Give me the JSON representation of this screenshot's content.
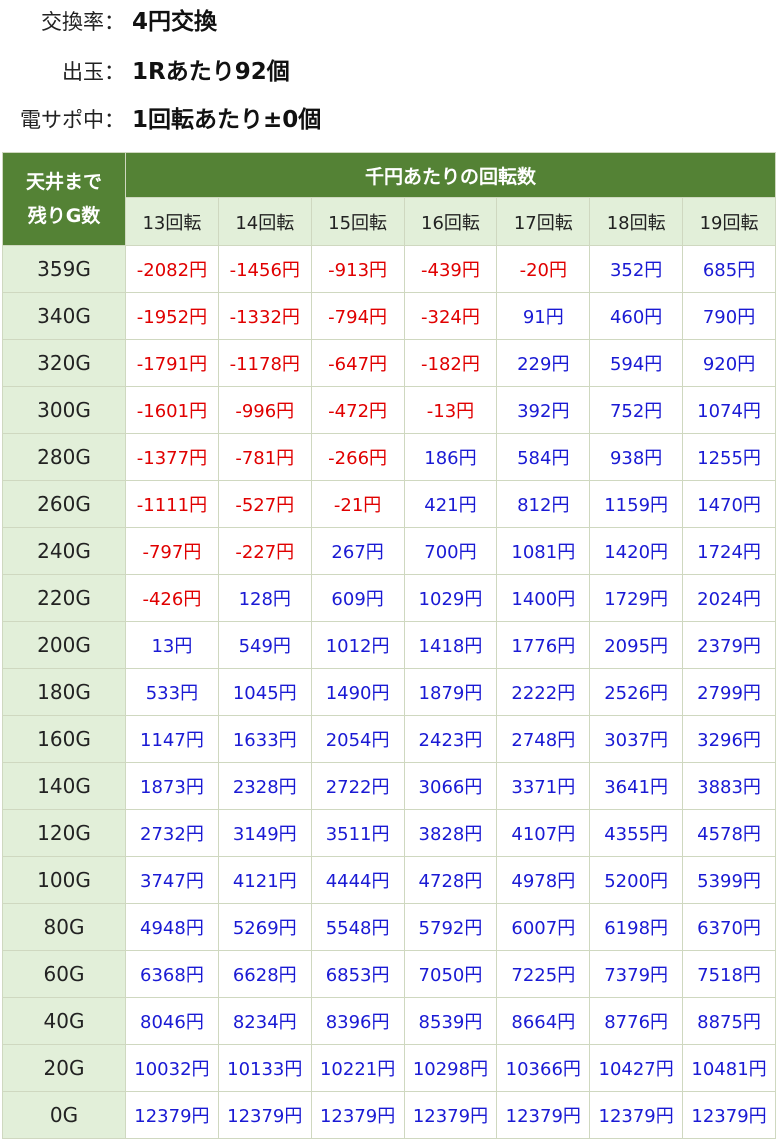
{
  "info": [
    {
      "label": "交換率：",
      "value": "4円交換"
    },
    {
      "label": "出玉：",
      "value": "1Rあたり92個"
    },
    {
      "label": "電サポ中：",
      "value": "1回転あたり±0個"
    }
  ],
  "table": {
    "corner_line1": "天井まで",
    "corner_line2": "残りG数",
    "main_header": "千円あたりの回転数",
    "columns": [
      "13回転",
      "14回転",
      "15回転",
      "16回転",
      "17回転",
      "18回転",
      "19回転"
    ],
    "rows": [
      {
        "label": "359G",
        "values": [
          "-2082円",
          "-1456円",
          "-913円",
          "-439円",
          "-20円",
          "352円",
          "685円"
        ]
      },
      {
        "label": "340G",
        "values": [
          "-1952円",
          "-1332円",
          "-794円",
          "-324円",
          "91円",
          "460円",
          "790円"
        ]
      },
      {
        "label": "320G",
        "values": [
          "-1791円",
          "-1178円",
          "-647円",
          "-182円",
          "229円",
          "594円",
          "920円"
        ]
      },
      {
        "label": "300G",
        "values": [
          "-1601円",
          "-996円",
          "-472円",
          "-13円",
          "392円",
          "752円",
          "1074円"
        ]
      },
      {
        "label": "280G",
        "values": [
          "-1377円",
          "-781円",
          "-266円",
          "186円",
          "584円",
          "938円",
          "1255円"
        ]
      },
      {
        "label": "260G",
        "values": [
          "-1111円",
          "-527円",
          "-21円",
          "421円",
          "812円",
          "1159円",
          "1470円"
        ]
      },
      {
        "label": "240G",
        "values": [
          "-797円",
          "-227円",
          "267円",
          "700円",
          "1081円",
          "1420円",
          "1724円"
        ]
      },
      {
        "label": "220G",
        "values": [
          "-426円",
          "128円",
          "609円",
          "1029円",
          "1400円",
          "1729円",
          "2024円"
        ]
      },
      {
        "label": "200G",
        "values": [
          "13円",
          "549円",
          "1012円",
          "1418円",
          "1776円",
          "2095円",
          "2379円"
        ]
      },
      {
        "label": "180G",
        "values": [
          "533円",
          "1045円",
          "1490円",
          "1879円",
          "2222円",
          "2526円",
          "2799円"
        ]
      },
      {
        "label": "160G",
        "values": [
          "1147円",
          "1633円",
          "2054円",
          "2423円",
          "2748円",
          "3037円",
          "3296円"
        ]
      },
      {
        "label": "140G",
        "values": [
          "1873円",
          "2328円",
          "2722円",
          "3066円",
          "3371円",
          "3641円",
          "3883円"
        ]
      },
      {
        "label": "120G",
        "values": [
          "2732円",
          "3149円",
          "3511円",
          "3828円",
          "4107円",
          "4355円",
          "4578円"
        ]
      },
      {
        "label": "100G",
        "values": [
          "3747円",
          "4121円",
          "4444円",
          "4728円",
          "4978円",
          "5200円",
          "5399円"
        ]
      },
      {
        "label": "80G",
        "values": [
          "4948円",
          "5269円",
          "5548円",
          "5792円",
          "6007円",
          "6198円",
          "6370円"
        ]
      },
      {
        "label": "60G",
        "values": [
          "6368円",
          "6628円",
          "6853円",
          "7050円",
          "7225円",
          "7379円",
          "7518円"
        ]
      },
      {
        "label": "40G",
        "values": [
          "8046円",
          "8234円",
          "8396円",
          "8539円",
          "8664円",
          "8776円",
          "8875円"
        ]
      },
      {
        "label": "20G",
        "values": [
          "10032円",
          "10133円",
          "10221円",
          "10298円",
          "10366円",
          "10427円",
          "10481円"
        ]
      },
      {
        "label": "0G",
        "values": [
          "12379円",
          "12379円",
          "12379円",
          "12379円",
          "12379円",
          "12379円",
          "12379円"
        ]
      }
    ]
  },
  "colors": {
    "negative": "#e00000",
    "positive": "#1a1ad4",
    "header": "#548235",
    "header_light": "#e2efd9"
  }
}
